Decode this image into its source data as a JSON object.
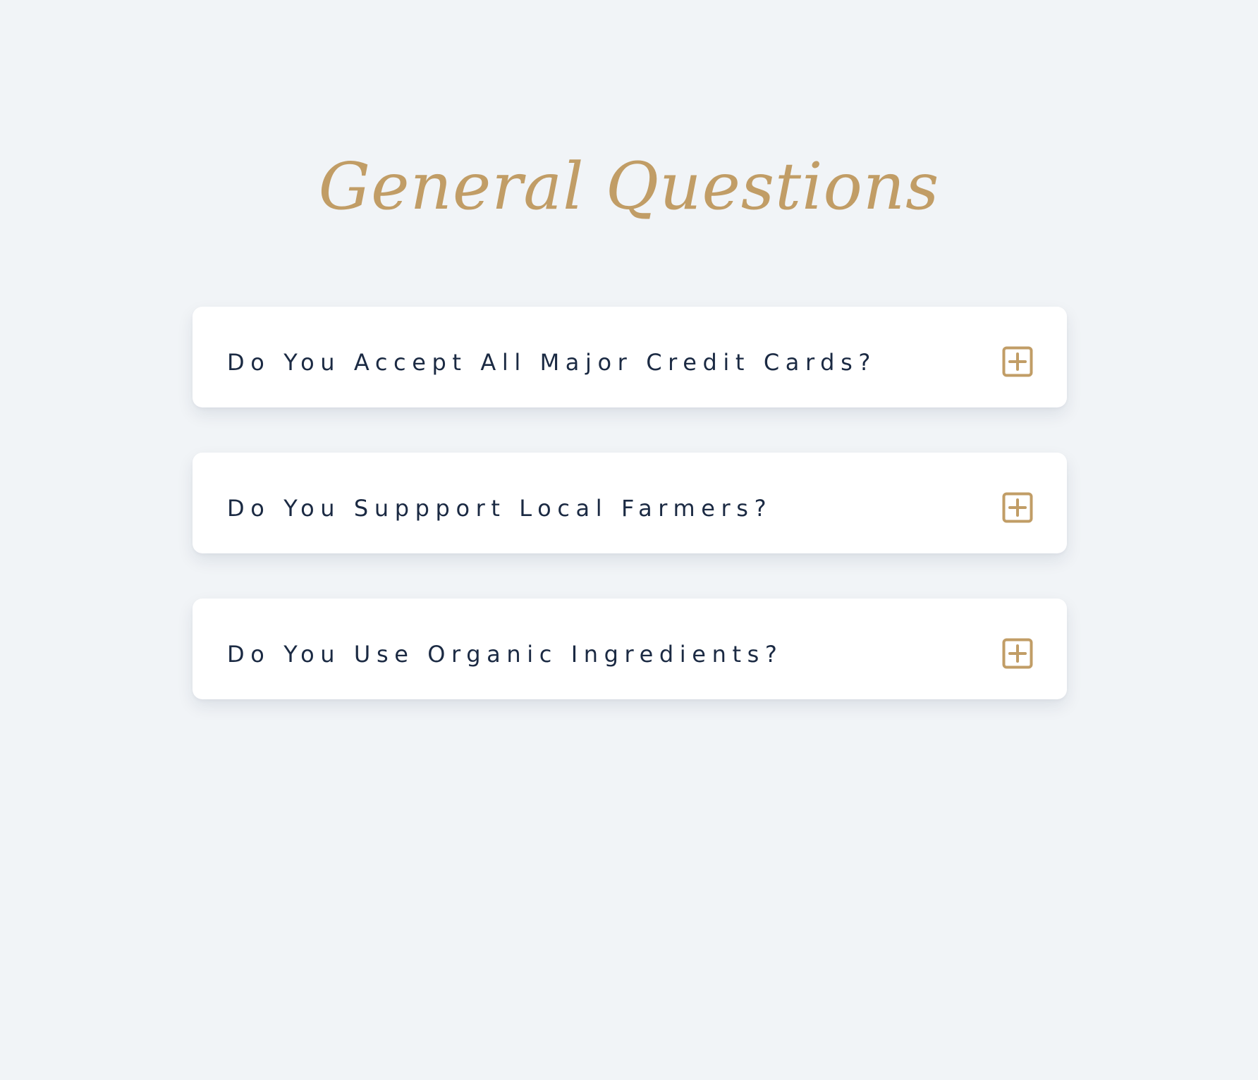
{
  "heading": "General Questions",
  "faq": {
    "items": [
      {
        "question": "Do You Accept All Major Credit Cards?",
        "expanded": false
      },
      {
        "question": "Do You Suppport Local Farmers?",
        "expanded": false
      },
      {
        "question": "Do You Use Organic Ingredients?",
        "expanded": false
      }
    ],
    "toggle_icon": "plus-square-icon"
  },
  "colors": {
    "background": "#f1f4f7",
    "accent": "#c19d66",
    "text": "#1b2a43",
    "card": "#ffffff"
  }
}
